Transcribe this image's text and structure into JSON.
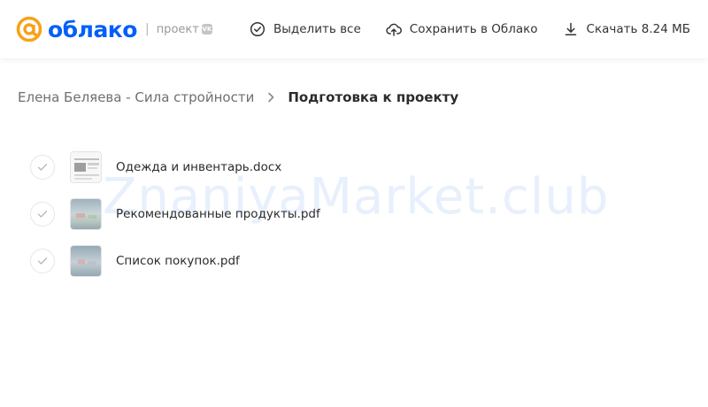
{
  "header": {
    "logo_text": "облако",
    "separator": "|",
    "project_label": "проект",
    "vk_badge": "VK",
    "actions": {
      "select_all": "Выделить все",
      "save_to_cloud": "Сохранить в Облако",
      "download": "Скачать 8.24 МБ"
    }
  },
  "breadcrumb": {
    "parent": "Елена Беляева - Сила стройности",
    "current": "Подготовка к проекту"
  },
  "files": [
    {
      "name": "Одежда и инвентарь.docx",
      "thumb": "document"
    },
    {
      "name": "Рекомендованные продукты.pdf",
      "thumb": "photo"
    },
    {
      "name": "Список покупок.pdf",
      "thumb": "photo"
    }
  ],
  "watermark": "ZnaniyaMarket.club",
  "colors": {
    "brand_orange": "#f7a21b",
    "brand_blue": "#005ff9",
    "text_primary": "#2b2b2b",
    "text_secondary": "#6f6f6f"
  }
}
